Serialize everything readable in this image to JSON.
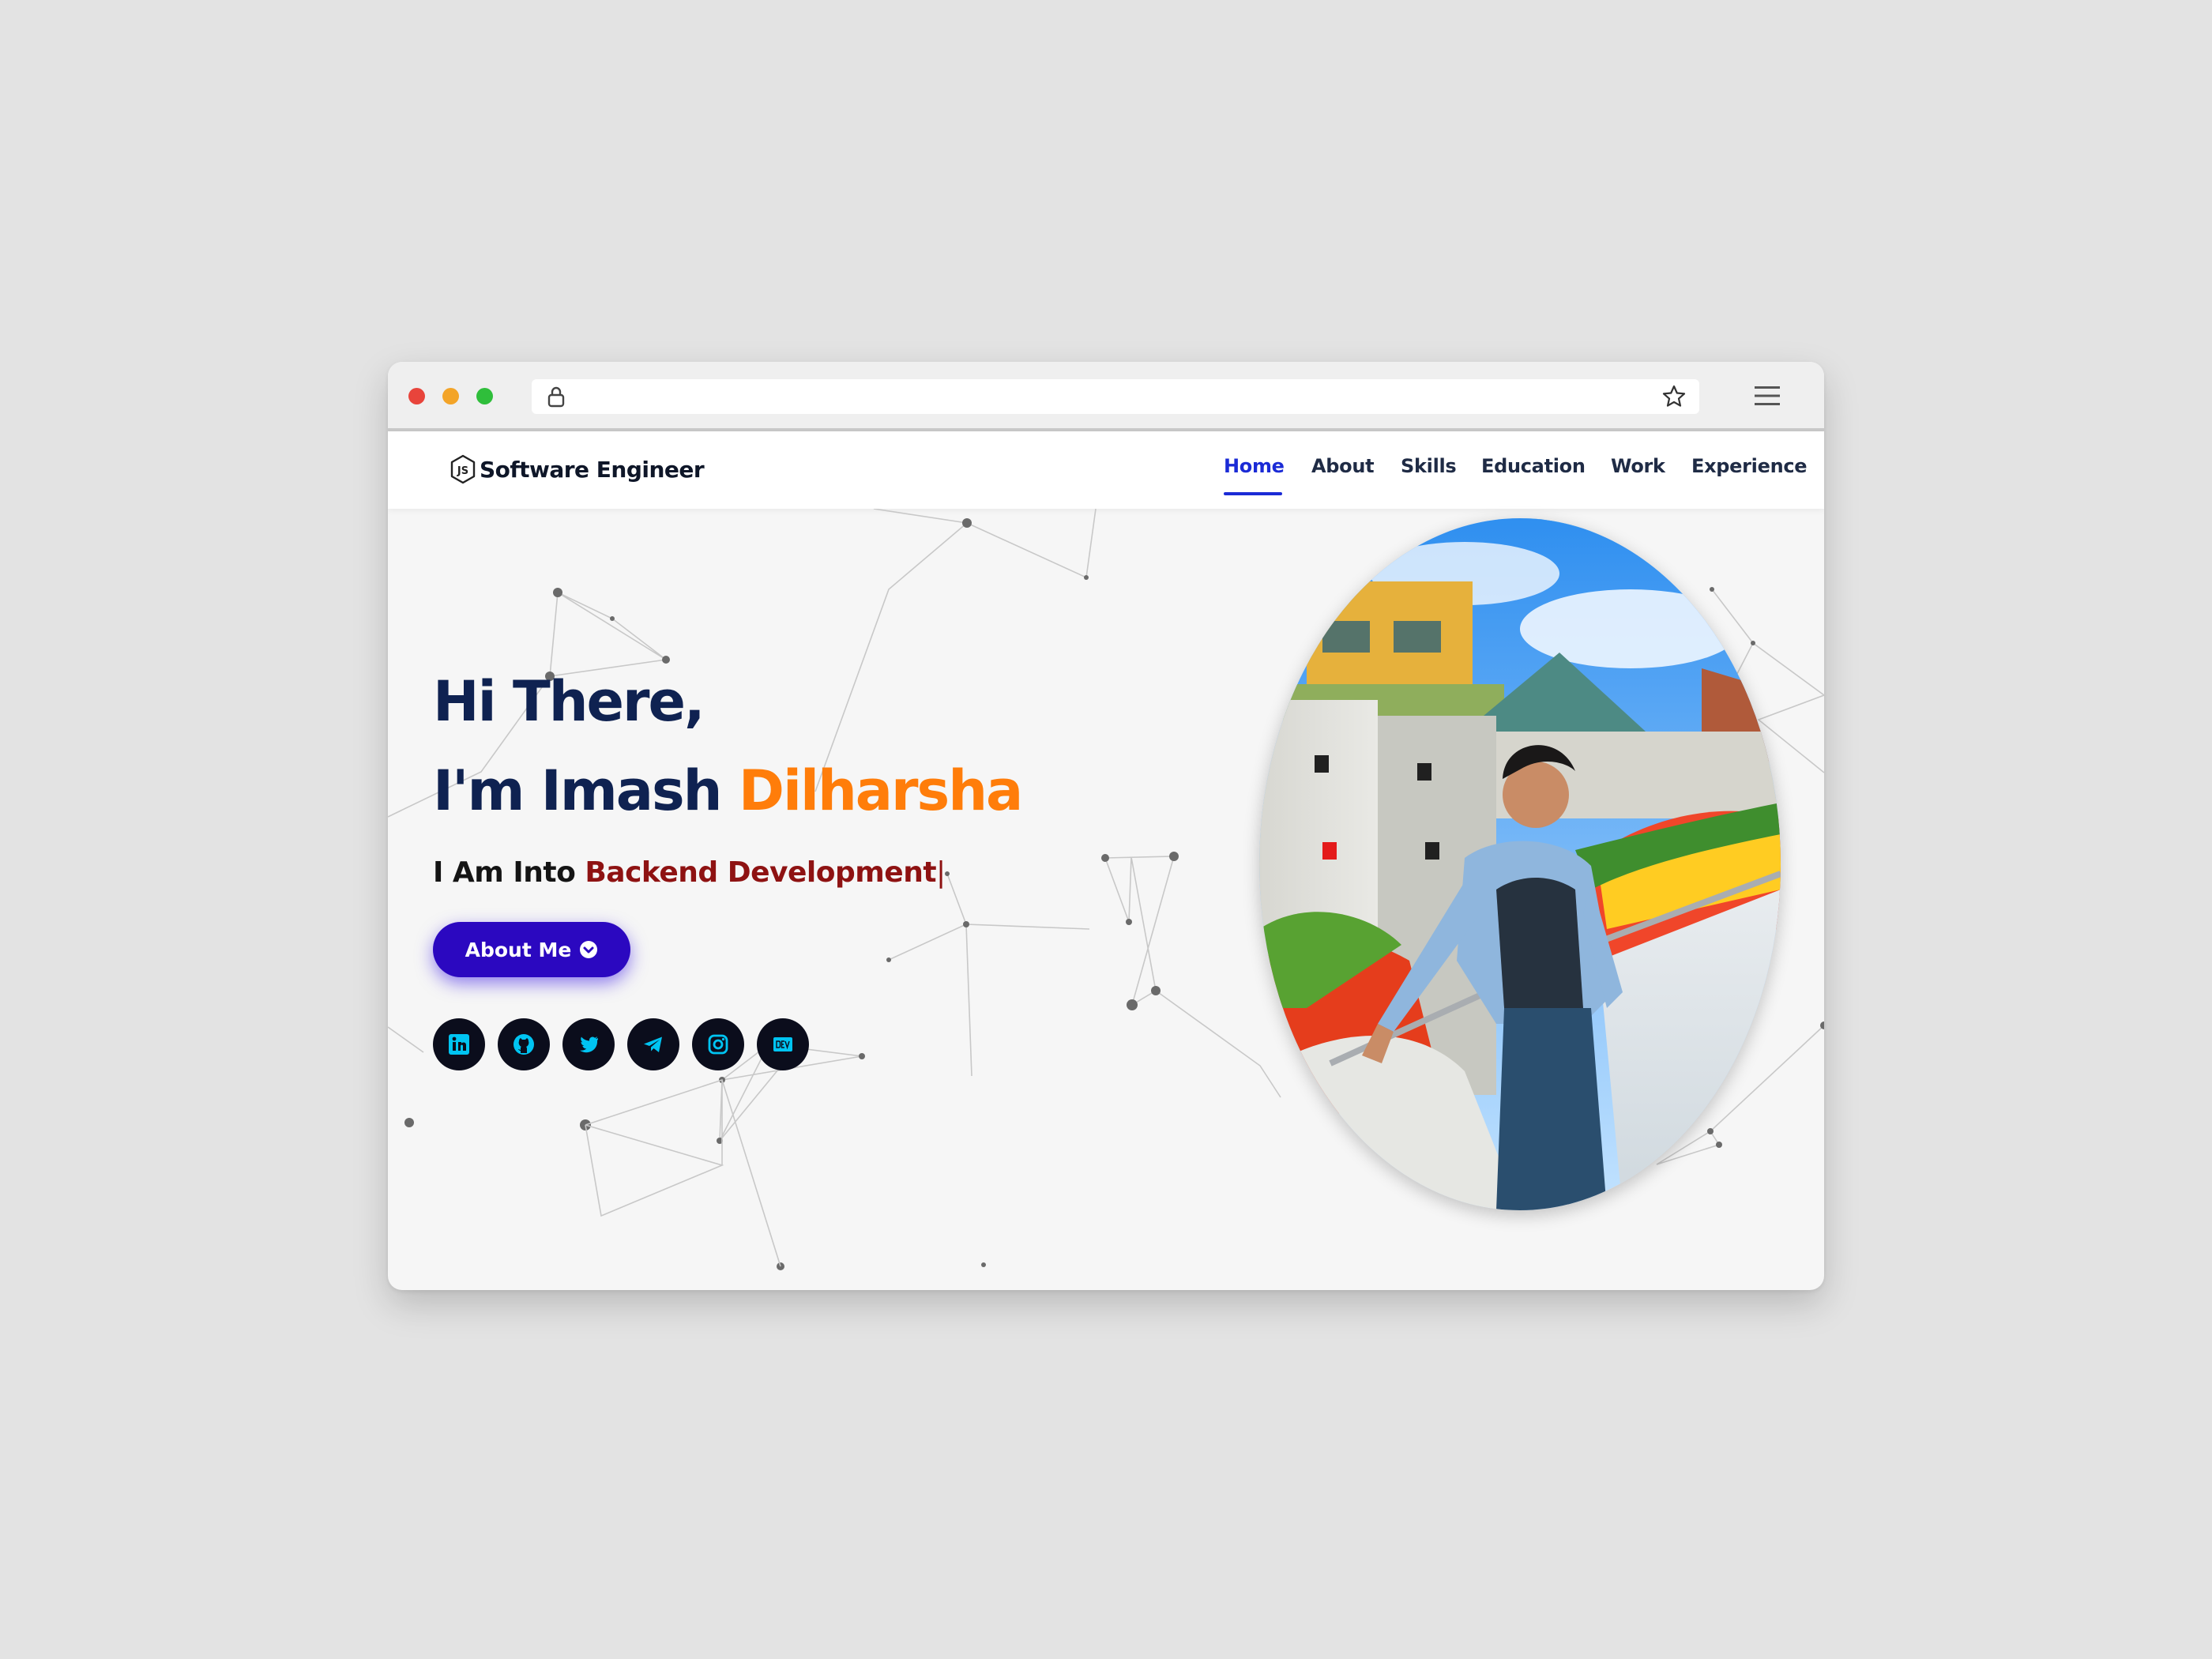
{
  "browser": {
    "url": "",
    "icons": [
      "lock-icon",
      "star-icon",
      "hamburger-menu-icon"
    ]
  },
  "navbar": {
    "brand": "Software Engineer",
    "brand_icon": "nodejs-logo-icon",
    "items": [
      {
        "label": "Home",
        "active": true
      },
      {
        "label": "About"
      },
      {
        "label": "Skills"
      },
      {
        "label": "Education"
      },
      {
        "label": "Work"
      },
      {
        "label": "Experience"
      }
    ]
  },
  "hero": {
    "greeting": "Hi There,",
    "intro": "I'm Imash ",
    "surname": "Dilharsha",
    "tagline_prefix": "I Am Into ",
    "tagline_typed": "Backend Development",
    "cursor": "|",
    "button_label": "About Me",
    "button_icon": "arrow-circle-down-icon",
    "socials": [
      "linkedin-icon",
      "github-icon",
      "twitter-icon",
      "telegram-icon",
      "instagram-icon",
      "dev-icon"
    ],
    "photo": "profile-photo"
  },
  "colors": {
    "heading": "#0f2251",
    "accent_orange": "#ff7d0a",
    "typed_red": "#8e1212",
    "button": "#2b08c0",
    "nav_active": "#1b2bd6",
    "social_icon": "#00c4f2"
  }
}
